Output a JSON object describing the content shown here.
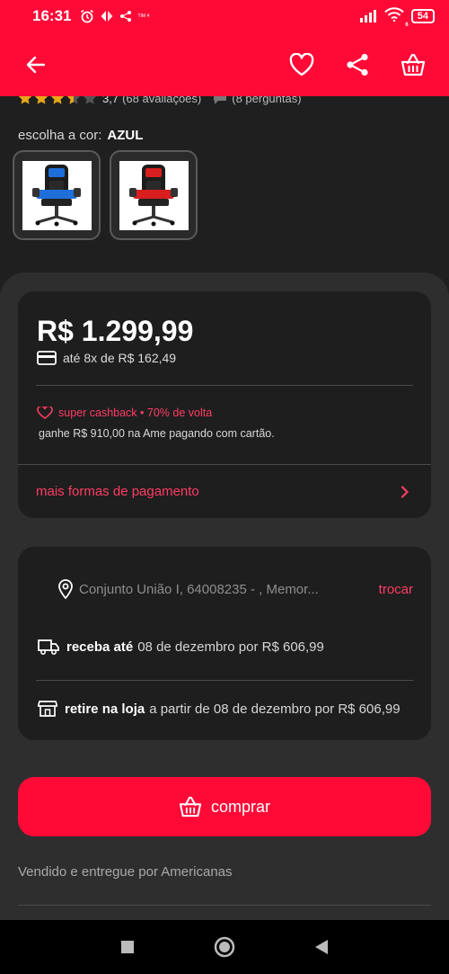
{
  "status_bar": {
    "time": "16:31",
    "carrier_tag": "TIM 4",
    "battery": "54",
    "wifi_badge": "6"
  },
  "app_bar": {
    "icons": [
      "back-arrow-icon",
      "heart-icon",
      "share-icon",
      "basket-icon"
    ]
  },
  "rating": {
    "stars": 3.5,
    "value": "3,7",
    "reviews": "(68 avaliações)",
    "questions": "(8 perguntas)"
  },
  "color_selector": {
    "label": "escolha a cor:",
    "selected": "AZUL",
    "options": [
      {
        "accent": "#1e6fd9"
      },
      {
        "accent": "#d81e1e"
      }
    ]
  },
  "price_card": {
    "price": "R$ 1.299,99",
    "installments": "até 8x de R$ 162,49",
    "cashback": "super cashback • 70% de volta",
    "cashback_detail": "ganhe R$ 910,00 na Ame pagando com cartão.",
    "more_payment": "mais formas de pagamento"
  },
  "shipping": {
    "address": "Conjunto União I, 64008235 - , Memor...",
    "change": "trocar",
    "delivery_label": "receba até",
    "delivery_text": "08 de dezembro por R$ 606,99",
    "pickup_label": "retire na loja",
    "pickup_text": "a partir de 08 de dezembro por R$ 606,99"
  },
  "buy": {
    "label": "comprar"
  },
  "seller": "Vendido e entregue por Americanas",
  "colors": {
    "brand": "#ff0a37",
    "accent_text": "#ff3c64",
    "background": "#1f1f1f",
    "card": "#1e1e1e",
    "sheet": "#2e2e2e"
  }
}
